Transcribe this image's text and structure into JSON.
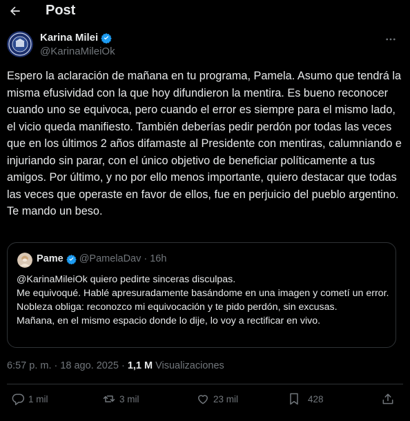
{
  "header": {
    "title": "Post",
    "back_icon": "arrow-left-icon"
  },
  "author": {
    "name": "Karina Milei",
    "handle": "@KarinaMileiOk",
    "verified_icon": "verified-badge-icon",
    "verified_color": "#1d9bf0"
  },
  "post": {
    "text": "Espero la aclaración de mañana en tu programa, Pamela. Asumo que tendrá la misma efusividad con la que hoy difundieron la mentira. Es bueno reconocer cuando uno se equivoca, pero cuando el error es siempre para el mismo lado, el vicio queda manifiesto. También deberías pedir perdón por todas las veces que en los últimos 2 años difamaste al Presidente con mentiras, calumniando e injuriando sin parar, con el único objetivo de beneficiar políticamente a tus amigos. Por último, y no por ello menos importante, quiero destacar que todas las veces que operaste en favor de ellos, fue en perjuicio del pueblo argentino. Te mando un beso."
  },
  "quote": {
    "name": "Pame",
    "handle": "@PamelaDav",
    "separator": "·",
    "time": "16h",
    "text": "@KarinaMileiOk quiero pedirte sinceras disculpas.\nMe equivoqué. Hablé apresuradamente basándome en una imagen y cometí un error. Nobleza obliga: reconozco mi equivocación y te pido perdón, sin excusas.\nMañana, en el mismo espacio donde lo dije, lo voy a rectificar en vivo."
  },
  "meta": {
    "time": "6:57 p. m.",
    "separator": "·",
    "date": "18 ago. 2025",
    "separator2": "·",
    "views_count": "1,1 M",
    "views_label": "Visualizaciones"
  },
  "actions": {
    "replies": "1 mil",
    "reposts": "3 mil",
    "likes": "23 mil",
    "bookmarks": "428"
  },
  "colors": {
    "background": "#000000",
    "text": "#e7e9ea",
    "muted": "#71767b",
    "border": "#2f3336"
  }
}
